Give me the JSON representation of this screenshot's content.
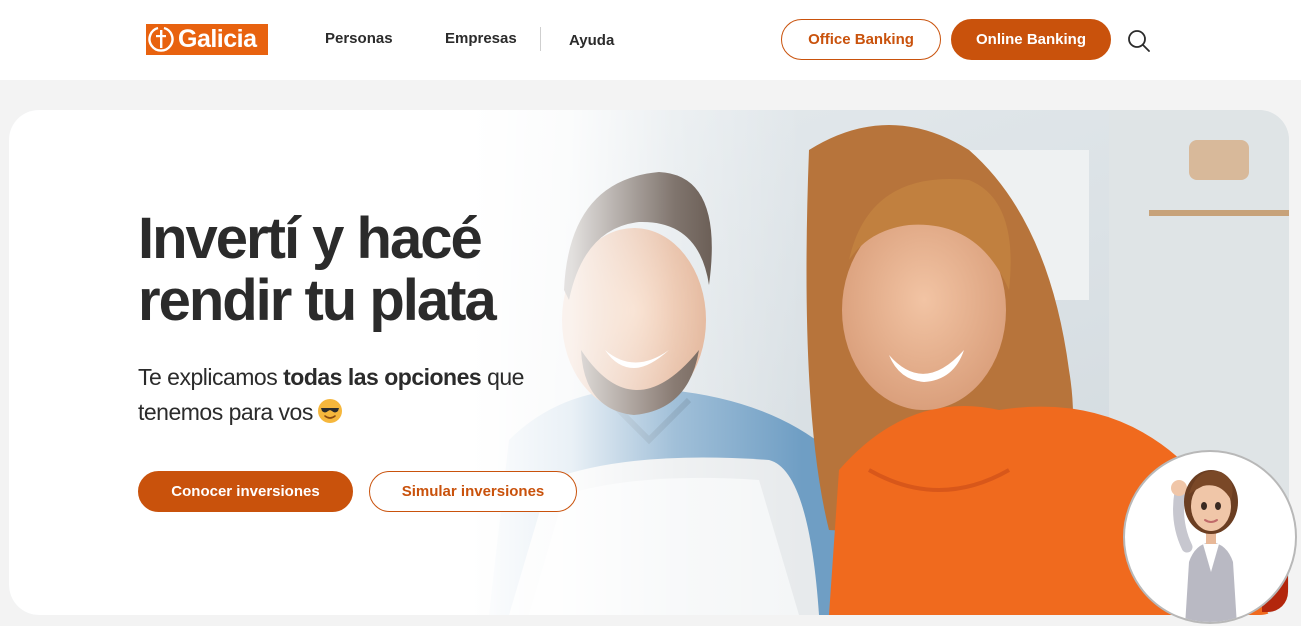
{
  "header": {
    "brand": "Galicia",
    "nav": [
      "Personas",
      "Empresas",
      "Ayuda"
    ],
    "office_banking": "Office Banking",
    "online_banking": "Online Banking",
    "search_icon": "search-icon"
  },
  "hero": {
    "title_line1": "Invertí y hacé",
    "title_line2": "rendir tu plata",
    "sub_part1": "Te explicamos ",
    "sub_bold": "todas las opciones",
    "sub_part2": " que tenemos para vos",
    "emoji_icon": "sunglasses-face-icon",
    "primary_cta": "Conocer inversiones",
    "secondary_cta": "Simular inversiones"
  },
  "colors": {
    "brand_orange": "#e8620f",
    "accent": "#c9520c",
    "text": "#2b2b2b",
    "background": "#f3f3f3"
  }
}
